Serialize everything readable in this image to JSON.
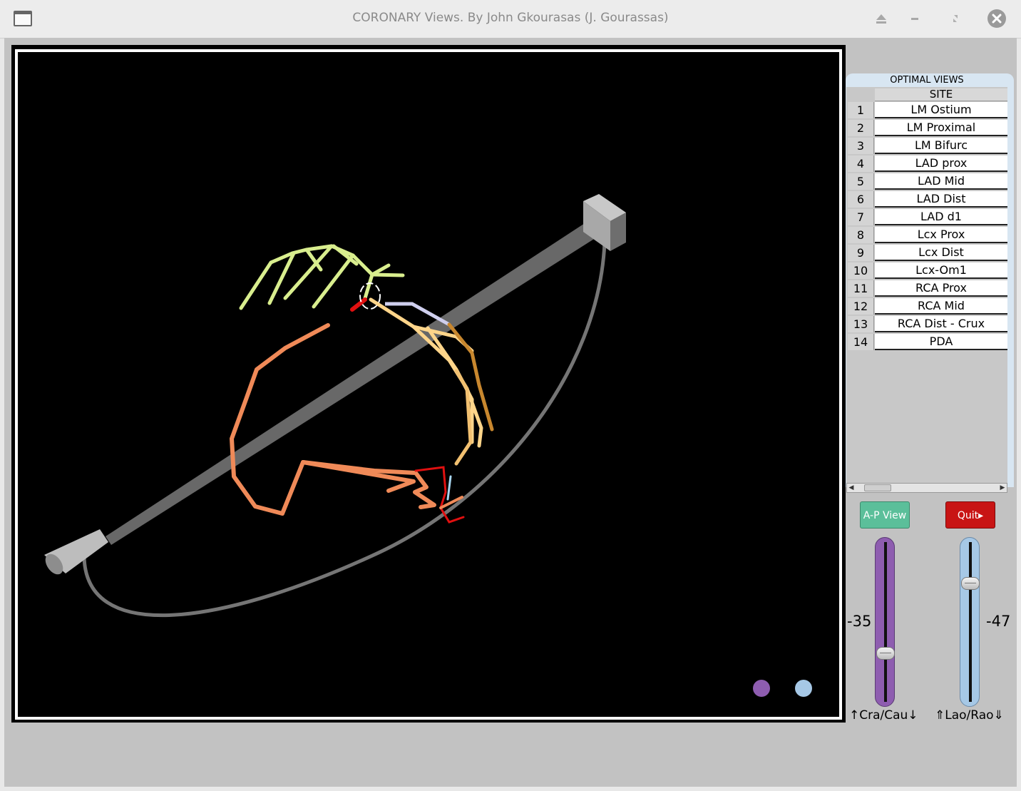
{
  "window": {
    "title": "CORONARY Views. By John Gkourasas (J. Gourassas)"
  },
  "table": {
    "caption": "OPTIMAL VIEWS",
    "column_header": "SITE",
    "rows": [
      {
        "num": "1",
        "site": "LM Ostium"
      },
      {
        "num": "2",
        "site": "LM Proximal"
      },
      {
        "num": "3",
        "site": "LM Bifurc"
      },
      {
        "num": "4",
        "site": "LAD prox"
      },
      {
        "num": "5",
        "site": "LAD Mid"
      },
      {
        "num": "6",
        "site": "LAD Dist"
      },
      {
        "num": "7",
        "site": "LAD d1"
      },
      {
        "num": "8",
        "site": "Lcx Prox"
      },
      {
        "num": "9",
        "site": "Lcx Dist"
      },
      {
        "num": "10",
        "site": "Lcx-Om1"
      },
      {
        "num": "11",
        "site": "RCA Prox"
      },
      {
        "num": "12",
        "site": "RCA Mid"
      },
      {
        "num": "13",
        "site": "RCA Dist - Crux"
      },
      {
        "num": "14",
        "site": "PDA"
      }
    ]
  },
  "controls": {
    "ap_view_label": "A-P View",
    "quit_label": "Quit▸",
    "cra_cau_value": "-35",
    "lao_rao_value": "-47",
    "cra_cau_label": "↑Cra/Cau↓",
    "lao_rao_label": "⇑Lao/Rao⇓",
    "cra_cau_colour": "#8e5db0",
    "lao_rao_colour": "#a6c8e6"
  },
  "icons": [
    "window-icon",
    "eject-icon",
    "minimize-icon",
    "restore-icon",
    "close-icon"
  ]
}
